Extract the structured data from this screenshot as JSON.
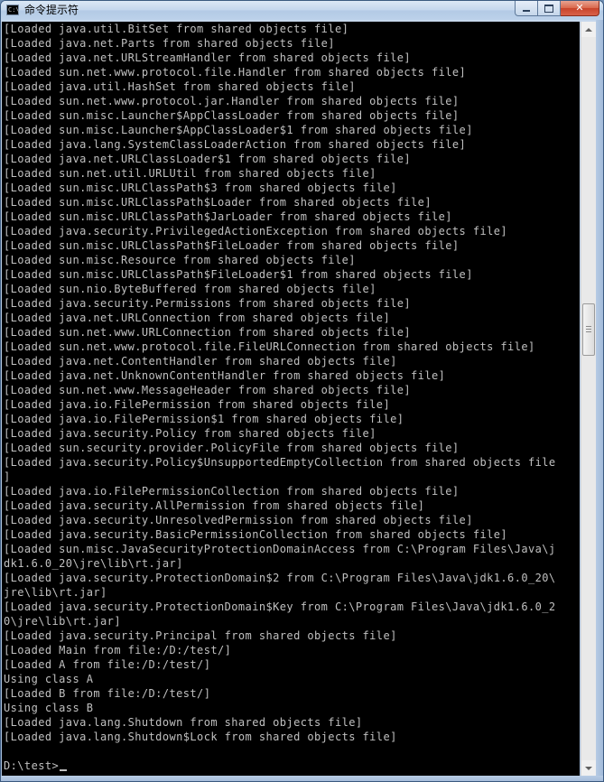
{
  "window": {
    "title": "命令提示符",
    "icon_text": "C:\\",
    "controls": {
      "minimize": "minimize",
      "maximize": "maximize",
      "close": "close"
    }
  },
  "console": {
    "lines": [
      "[Loaded java.util.BitSet from shared objects file]",
      "[Loaded java.net.Parts from shared objects file]",
      "[Loaded java.net.URLStreamHandler from shared objects file]",
      "[Loaded sun.net.www.protocol.file.Handler from shared objects file]",
      "[Loaded java.util.HashSet from shared objects file]",
      "[Loaded sun.net.www.protocol.jar.Handler from shared objects file]",
      "[Loaded sun.misc.Launcher$AppClassLoader from shared objects file]",
      "[Loaded sun.misc.Launcher$AppClassLoader$1 from shared objects file]",
      "[Loaded java.lang.SystemClassLoaderAction from shared objects file]",
      "[Loaded java.net.URLClassLoader$1 from shared objects file]",
      "[Loaded sun.net.util.URLUtil from shared objects file]",
      "[Loaded sun.misc.URLClassPath$3 from shared objects file]",
      "[Loaded sun.misc.URLClassPath$Loader from shared objects file]",
      "[Loaded sun.misc.URLClassPath$JarLoader from shared objects file]",
      "[Loaded java.security.PrivilegedActionException from shared objects file]",
      "[Loaded sun.misc.URLClassPath$FileLoader from shared objects file]",
      "[Loaded sun.misc.Resource from shared objects file]",
      "[Loaded sun.misc.URLClassPath$FileLoader$1 from shared objects file]",
      "[Loaded sun.nio.ByteBuffered from shared objects file]",
      "[Loaded java.security.Permissions from shared objects file]",
      "[Loaded java.net.URLConnection from shared objects file]",
      "[Loaded sun.net.www.URLConnection from shared objects file]",
      "[Loaded sun.net.www.protocol.file.FileURLConnection from shared objects file]",
      "[Loaded java.net.ContentHandler from shared objects file]",
      "[Loaded java.net.UnknownContentHandler from shared objects file]",
      "[Loaded sun.net.www.MessageHeader from shared objects file]",
      "[Loaded java.io.FilePermission from shared objects file]",
      "[Loaded java.io.FilePermission$1 from shared objects file]",
      "[Loaded java.security.Policy from shared objects file]",
      "[Loaded sun.security.provider.PolicyFile from shared objects file]",
      "[Loaded java.security.Policy$UnsupportedEmptyCollection from shared objects file",
      "]",
      "[Loaded java.io.FilePermissionCollection from shared objects file]",
      "[Loaded java.security.AllPermission from shared objects file]",
      "[Loaded java.security.UnresolvedPermission from shared objects file]",
      "[Loaded java.security.BasicPermissionCollection from shared objects file]",
      "[Loaded sun.misc.JavaSecurityProtectionDomainAccess from C:\\Program Files\\Java\\j",
      "dk1.6.0_20\\jre\\lib\\rt.jar]",
      "[Loaded java.security.ProtectionDomain$2 from C:\\Program Files\\Java\\jdk1.6.0_20\\",
      "jre\\lib\\rt.jar]",
      "[Loaded java.security.ProtectionDomain$Key from C:\\Program Files\\Java\\jdk1.6.0_2",
      "0\\jre\\lib\\rt.jar]",
      "[Loaded java.security.Principal from shared objects file]",
      "[Loaded Main from file:/D:/test/]",
      "[Loaded A from file:/D:/test/]",
      "Using class A",
      "[Loaded B from file:/D:/test/]",
      "Using class B",
      "[Loaded java.lang.Shutdown from shared objects file]",
      "[Loaded java.lang.Shutdown$Lock from shared objects file]",
      ""
    ],
    "prompt": "D:\\test>"
  },
  "colors": {
    "console_background": "#000000",
    "console_text": "#c0c0c0",
    "close_button": "#c8442a"
  }
}
